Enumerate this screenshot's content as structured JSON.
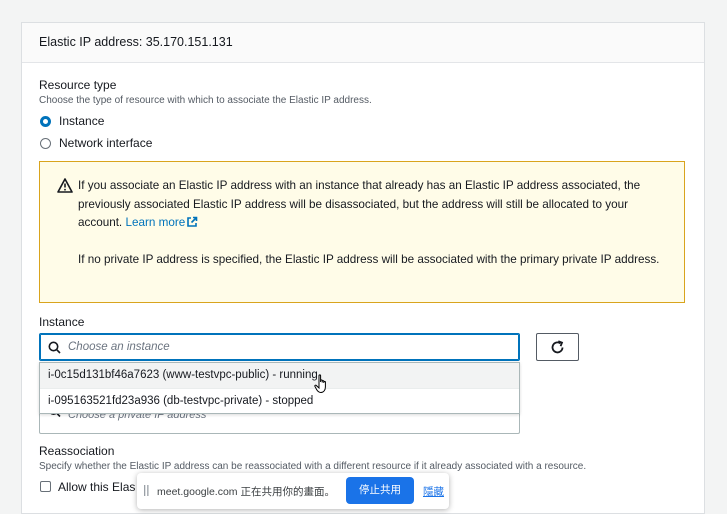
{
  "header": {
    "title": "Elastic IP address: 35.170.151.131"
  },
  "resource_type": {
    "label": "Resource type",
    "description": "Choose the type of resource with which to associate the Elastic IP address.",
    "options": [
      {
        "label": "Instance",
        "checked": true
      },
      {
        "label": "Network interface",
        "checked": false
      }
    ]
  },
  "alert": {
    "text1": "If you associate an Elastic IP address with an instance that already has an Elastic IP address associated, the previously associated Elastic IP address will be disassociated, but the address will still be allocated to your account.",
    "learn_more": "Learn more",
    "text2": "If no private IP address is specified, the Elastic IP address will be associated with the primary private IP address."
  },
  "instance": {
    "label": "Instance",
    "placeholder": "Choose an instance",
    "options": [
      "i-0c15d131bf46a7623 (www-testvpc-public) - running",
      "i-095163521fd23a936 (db-testvpc-private) - stopped"
    ]
  },
  "private_ip": {
    "placeholder": "Choose a private IP address"
  },
  "reassociation": {
    "label": "Reassociation",
    "description": "Specify whether the Elastic IP address can be reassociated with a different resource if it already associated with a resource.",
    "checkbox_label": "Allow this Elas"
  },
  "share_bar": {
    "message": "meet.google.com 正在共用你的畫面。",
    "stop_label": "停止共用",
    "hide_label": "隱藏"
  },
  "colors": {
    "accent": "#0073bb",
    "warning_border": "#d9a41d",
    "warning_bg": "#fffce8",
    "meet_blue": "#1a73e8"
  }
}
